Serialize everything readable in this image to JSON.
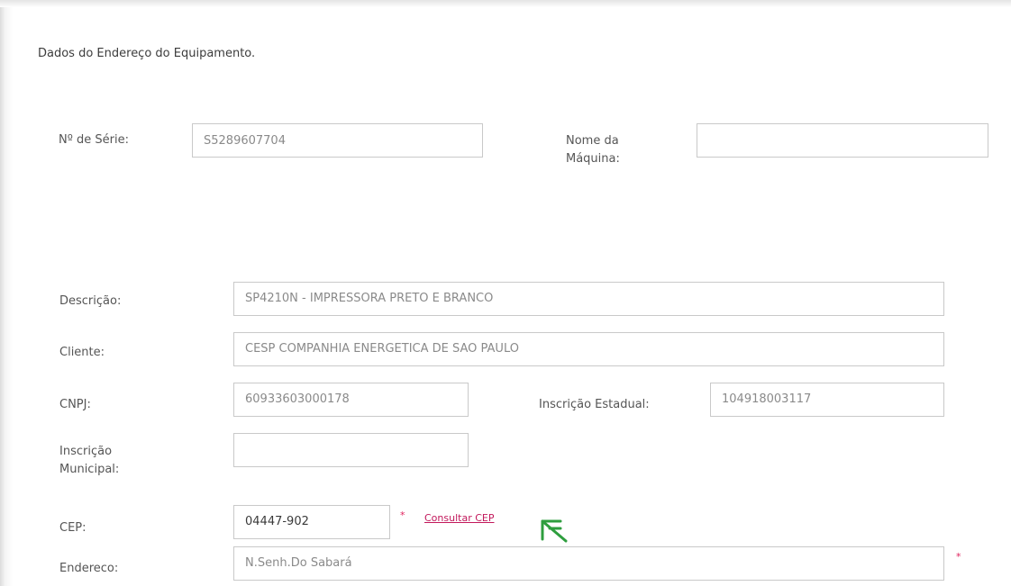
{
  "section_title": "Dados do Endereço do Equipamento.",
  "fields": {
    "serie": {
      "label": "Nº de Série:",
      "value": "S5289607704"
    },
    "nome_maquina": {
      "label": "Nome da Máquina:",
      "label_line1": "Nome da",
      "label_line2": "Máquina:",
      "value": ""
    },
    "descricao": {
      "label": "Descrição:",
      "value": "SP4210N - IMPRESSORA PRETO E BRANCO"
    },
    "cliente": {
      "label": "Cliente:",
      "value": "CESP COMPANHIA ENERGETICA DE SAO PAULO"
    },
    "cnpj": {
      "label": "CNPJ:",
      "value": "60933603000178"
    },
    "inscricao_estadual": {
      "label": "Inscrição Estadual:",
      "value": "104918003117"
    },
    "inscricao_municipal": {
      "label": "Inscrição Municipal:",
      "label_line1": "Inscrição",
      "label_line2": "Municipal:",
      "value": ""
    },
    "cep": {
      "label": "CEP:",
      "value": "04447-902",
      "required_mark": "*",
      "lookup_link": "Consultar CEP"
    },
    "endereco": {
      "label": "Endereco:",
      "value": "N.Senh.Do Sabará",
      "required_mark": "*"
    }
  },
  "colors": {
    "required": "#e0245e",
    "link": "#c2185b",
    "annotation_arrow": "#2e9e3e"
  },
  "icons": {
    "annotation": "double-chevron-arrow-icon"
  }
}
